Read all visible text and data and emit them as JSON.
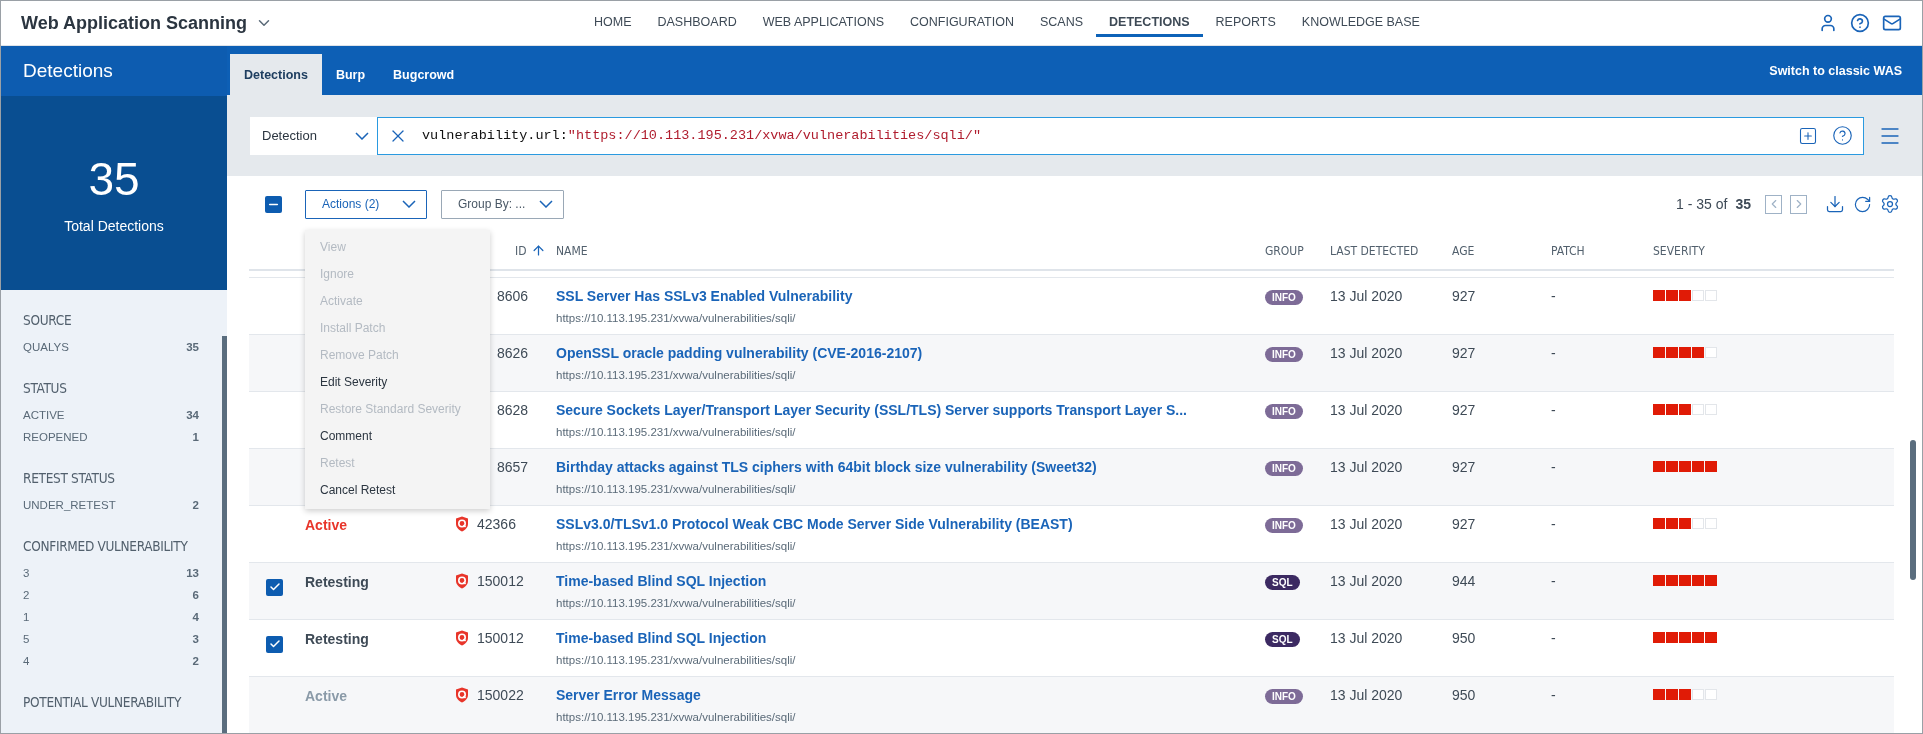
{
  "app": {
    "title": "Web Application Scanning"
  },
  "nav": [
    {
      "label": "HOME",
      "selected": false
    },
    {
      "label": "DASHBOARD",
      "selected": false
    },
    {
      "label": "WEB APPLICATIONS",
      "selected": false
    },
    {
      "label": "CONFIGURATION",
      "selected": false
    },
    {
      "label": "SCANS",
      "selected": false
    },
    {
      "label": "DETECTIONS",
      "selected": true
    },
    {
      "label": "REPORTS",
      "selected": false
    },
    {
      "label": "KNOWLEDGE BASE",
      "selected": false
    }
  ],
  "subtabs": [
    {
      "label": "Detections",
      "selected": true
    },
    {
      "label": "Burp",
      "selected": false
    },
    {
      "label": "Bugcrowd",
      "selected": false
    }
  ],
  "switch_link": "Switch to classic WAS",
  "sidebar": {
    "title": "Detections",
    "total": "35",
    "total_label": "Total Detections",
    "facets": [
      {
        "title": "SOURCE",
        "items": [
          {
            "label": "QUALYS",
            "count": "35"
          }
        ]
      },
      {
        "title": "STATUS",
        "items": [
          {
            "label": "ACTIVE",
            "count": "34"
          },
          {
            "label": "REOPENED",
            "count": "1"
          }
        ]
      },
      {
        "title": "RETEST STATUS",
        "items": [
          {
            "label": "UNDER_RETEST",
            "count": "2"
          }
        ]
      },
      {
        "title": "CONFIRMED VULNERABILITY",
        "items": [
          {
            "label": "3",
            "count": "13"
          },
          {
            "label": "2",
            "count": "6"
          },
          {
            "label": "1",
            "count": "4"
          },
          {
            "label": "5",
            "count": "3"
          },
          {
            "label": "4",
            "count": "2"
          }
        ]
      },
      {
        "title": "POTENTIAL VULNERABILITY"
      }
    ]
  },
  "search": {
    "field": "Detection",
    "query_key": "vulnerability.url:",
    "query_value": "\"https://10.113.195.231/xvwa/vulnerabilities/sqli/\""
  },
  "toolbar": {
    "select_all_indeterminate": true,
    "actions": "Actions (2)",
    "group_by": "Group By: ...",
    "range": "1 - 35 of",
    "total": "35"
  },
  "actions_menu": [
    {
      "label": "View",
      "disabled": true
    },
    {
      "label": "Ignore",
      "disabled": true
    },
    {
      "label": "Activate",
      "disabled": true
    },
    {
      "label": "Install Patch",
      "disabled": true
    },
    {
      "label": "Remove Patch",
      "disabled": true
    },
    {
      "label": "Edit Severity",
      "disabled": false
    },
    {
      "label": "Restore Standard Severity",
      "disabled": true
    },
    {
      "label": "Comment",
      "disabled": false
    },
    {
      "label": "Retest",
      "disabled": true
    },
    {
      "label": "Cancel Retest",
      "disabled": false
    }
  ],
  "columns": [
    "ID",
    "NAME",
    "GROUP",
    "LAST DETECTED",
    "AGE",
    "PATCH",
    "SEVERITY"
  ],
  "rows": [
    {
      "checked": false,
      "qid": "8606",
      "icon": false,
      "name": "SSL Server Has SSLv3 Enabled Vulnerability",
      "url": "https://10.113.195.231/xvwa/vulnerabilities/sqli/",
      "group": {
        "label": "INFO",
        "color": "#7d6b97"
      },
      "last_detected": "13 Jul 2020",
      "age": "927",
      "patch": "-",
      "stars": 3
    },
    {
      "checked": false,
      "qid": "8626",
      "icon": false,
      "name": "OpenSSL oracle padding vulnerability (CVE-2016-2107)",
      "url": "https://10.113.195.231/xvwa/vulnerabilities/sqli/",
      "group": {
        "label": "INFO",
        "color": "#7d6b97"
      },
      "last_detected": "13 Jul 2020",
      "age": "927",
      "patch": "-",
      "stars": 4
    },
    {
      "checked": false,
      "qid": "8628",
      "icon": false,
      "name": "Secure Sockets Layer/Transport Layer Security (SSL/TLS) Server supports Transport Layer S...",
      "url": "https://10.113.195.231/xvwa/vulnerabilities/sqli/",
      "group": {
        "label": "INFO",
        "color": "#7d6b97"
      },
      "last_detected": "13 Jul 2020",
      "age": "927",
      "patch": "-",
      "stars": 3
    },
    {
      "checked": false,
      "qid": "8657",
      "icon": false,
      "name": "Birthday attacks against TLS ciphers with 64bit block size vulnerability (Sweet32)",
      "url": "https://10.113.195.231/xvwa/vulnerabilities/sqli/",
      "group": {
        "label": "INFO",
        "color": "#7d6b97"
      },
      "last_detected": "13 Jul 2020",
      "age": "927",
      "patch": "-",
      "stars": 5
    },
    {
      "checked": false,
      "status": {
        "label": "Active",
        "color": "#e8352a"
      },
      "qid": "42366",
      "icon": true,
      "name": "SSLv3.0/TLSv1.0 Protocol Weak CBC Mode Server Side Vulnerability (BEAST)",
      "url": "https://10.113.195.231/xvwa/vulnerabilities/sqli/",
      "group": {
        "label": "INFO",
        "color": "#7d6b97"
      },
      "last_detected": "13 Jul 2020",
      "age": "927",
      "patch": "-",
      "stars": 3
    },
    {
      "checked": true,
      "status": {
        "label": "Retesting",
        "color": "#3e4a56"
      },
      "qid": "150012",
      "icon": true,
      "name": "Time-based Blind SQL Injection",
      "url": "https://10.113.195.231/xvwa/vulnerabilities/sqli/",
      "group": {
        "label": "SQL",
        "color": "#3c2a62"
      },
      "last_detected": "13 Jul 2020",
      "age": "944",
      "patch": "-",
      "stars": 5
    },
    {
      "checked": true,
      "status": {
        "label": "Retesting",
        "color": "#3e4a56"
      },
      "qid": "150012",
      "icon": true,
      "name": "Time-based Blind SQL Injection",
      "url": "https://10.113.195.231/xvwa/vulnerabilities/sqli/",
      "group": {
        "label": "SQL",
        "color": "#3c2a62"
      },
      "last_detected": "13 Jul 2020",
      "age": "950",
      "patch": "-",
      "stars": 5
    },
    {
      "checked": false,
      "status": {
        "label": "Active",
        "color": "#8a9aa8"
      },
      "qid": "150022",
      "icon": true,
      "name": "Server Error Message",
      "url": "https://10.113.195.231/xvwa/vulnerabilities/sqli/",
      "group": {
        "label": "INFO",
        "color": "#7d6b97"
      },
      "last_detected": "13 Jul 2020",
      "age": "950",
      "patch": "-",
      "stars": 3
    }
  ]
}
